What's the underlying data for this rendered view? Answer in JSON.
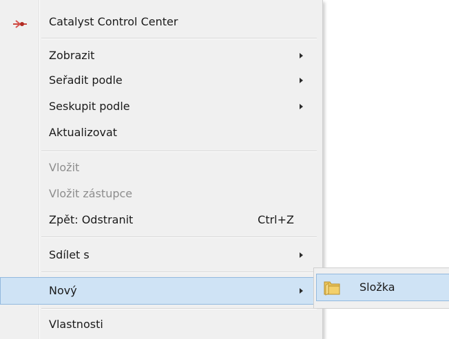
{
  "context_menu": {
    "header_item": {
      "label": "Catalyst Control Center",
      "icon": "catalyst-icon"
    },
    "view_items": [
      {
        "label": "Zobrazit",
        "submenu": true
      },
      {
        "label": "Seřadit podle",
        "submenu": true
      },
      {
        "label": "Seskupit podle",
        "submenu": true
      },
      {
        "label": "Aktualizovat",
        "submenu": false
      }
    ],
    "edit_items": [
      {
        "label": "Vložit",
        "disabled": true
      },
      {
        "label": "Vložit zástupce",
        "disabled": true
      },
      {
        "label": "Zpět: Odstranit",
        "shortcut": "Ctrl+Z"
      }
    ],
    "share_item": {
      "label": "Sdílet s",
      "submenu": true
    },
    "new_item": {
      "label": "Nový",
      "submenu": true,
      "highlighted": true
    },
    "properties_item": {
      "label": "Vlastnosti"
    }
  },
  "submenu": {
    "items": [
      {
        "label": "Složka",
        "icon": "folder-icon",
        "highlighted": true
      }
    ]
  },
  "colors": {
    "menu_background": "#f0f0f0",
    "highlight_background": "#cfe3f5",
    "highlight_border": "#92b9de",
    "disabled_text": "#8d8d8d"
  }
}
